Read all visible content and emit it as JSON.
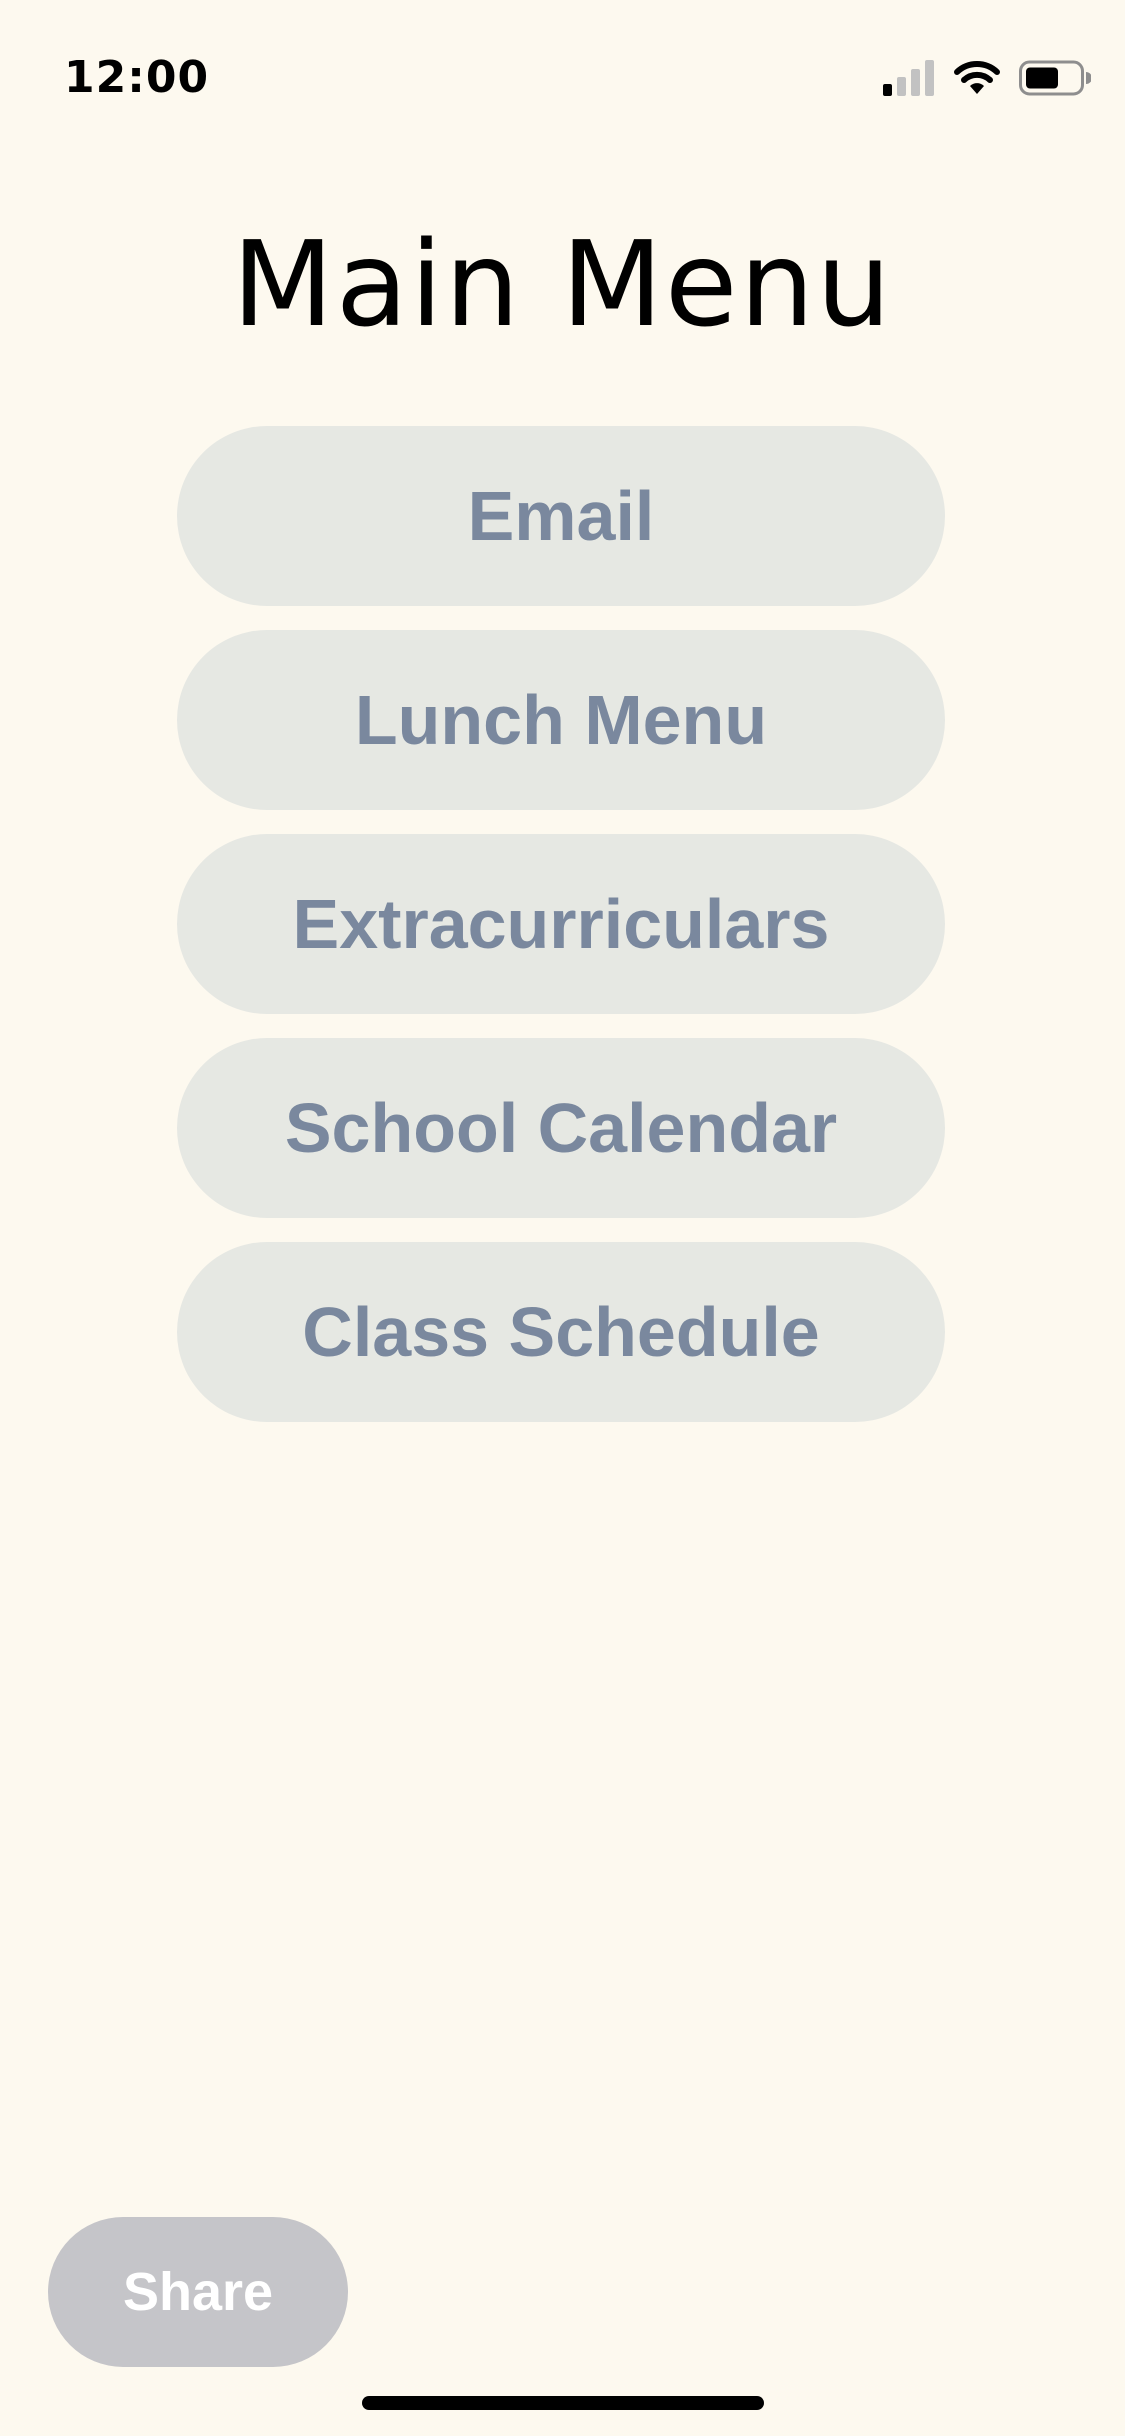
{
  "status_bar": {
    "time": "12:00",
    "icons": [
      "cellular-signal-icon",
      "wifi-icon",
      "battery-icon"
    ]
  },
  "page": {
    "title": "Main Menu"
  },
  "menu": {
    "items": [
      {
        "label": "Email"
      },
      {
        "label": "Lunch Menu"
      },
      {
        "label": "Extracurriculars"
      },
      {
        "label": "School Calendar"
      },
      {
        "label": "Class Schedule"
      }
    ]
  },
  "footer": {
    "share_label": "Share"
  },
  "colors": {
    "background": "#fdf9ef",
    "menu_button_bg": "#e6e8e3",
    "menu_button_text": "#7a889e",
    "share_button_bg": "#c5c5c9",
    "share_button_text": "#ffffff"
  }
}
